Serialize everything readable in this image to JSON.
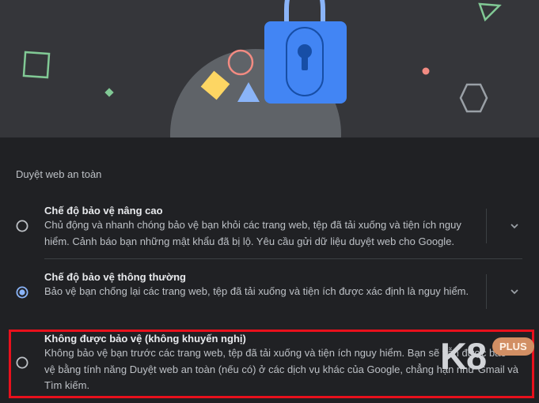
{
  "section": {
    "title": "Duyệt web an toàn"
  },
  "options": [
    {
      "title": "Chế độ bảo vệ nâng cao",
      "description": "Chủ động và nhanh chóng bảo vệ bạn khỏi các trang web, tệp đã tải xuống và tiện ích nguy hiểm. Cảnh báo bạn những mật khẩu đã bị lộ. Yêu cầu gửi dữ liệu duyệt web cho Google.",
      "selected": false,
      "expand_icon": "chevron-down-icon"
    },
    {
      "title": "Chế độ bảo vệ thông thường",
      "description": "Bảo vệ bạn chống lại các trang web, tệp đã tải xuống và tiện ích được xác định là nguy hiểm.",
      "selected": true,
      "expand_icon": "chevron-down-icon"
    },
    {
      "title": "Không được bảo vệ (không khuyến nghị)",
      "description": "Không bảo vệ bạn trước các trang web, tệp đã tải xuống và tiện ích nguy hiểm. Bạn sẽ vẫn được bảo vệ bằng tính năng Duyệt web an toàn (nếu có) ở các dịch vụ khác của Google, chẳng hạn như Gmail và Tìm kiếm.",
      "selected": false
    }
  ],
  "watermark": {
    "brand": "K8",
    "badge": "PLUS"
  },
  "colors": {
    "accent": "#8ab4f8",
    "lock": "#4285f4",
    "highlight_border": "#e8101c",
    "background": "#202124"
  }
}
